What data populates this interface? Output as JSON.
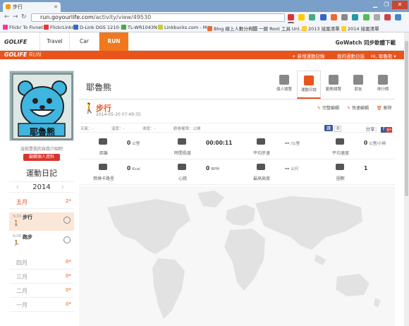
{
  "browser": {
    "tab_title": "步行",
    "url_domain": "run.goyourlife.com",
    "url_path": "/activity/view/49530",
    "bookmarks": [
      "Flickr To Fivnet",
      "FlickrLinkr",
      "D-Link DGS 1210-16",
      "TL-WR1043N",
      "Linkbucks.com - M...",
      "Blog 線上人數分佈",
      "一鍵 Root 工具 Unl...",
      "2013 接案清單",
      "2014 接案清單"
    ]
  },
  "site": {
    "logo": "GOLIFE",
    "tabs": [
      "Travel",
      "Car",
      "RUN"
    ],
    "active_tab": "RUN",
    "gowatch": "GoWatch 同步軟體下載",
    "run_logo_a": "GOLIFE",
    "run_logo_b": "RUN",
    "links": [
      "+ 新增運動記錄",
      "我的運動日誌",
      "Hi, 耶魯熊 ▾"
    ]
  },
  "profile": {
    "avatar_text": "耶魯熊",
    "motto": "這就是我的自我介紹吧",
    "edit_button": "編輯個人資料"
  },
  "diary": {
    "title": "運動日記",
    "year": "2014",
    "months": [
      {
        "name": "五月",
        "count": "2*",
        "active": true
      },
      {
        "name": "四月",
        "count": "0*"
      },
      {
        "name": "三月",
        "count": "0*"
      },
      {
        "name": "二月",
        "count": "0*"
      },
      {
        "name": "一月",
        "count": "0*"
      }
    ],
    "entries": [
      {
        "date": "5/20",
        "name": "步行",
        "selected": true
      },
      {
        "date": "5/20",
        "name": "跑步"
      }
    ]
  },
  "main": {
    "username": "耶魯熊",
    "nav": [
      "個人總覽",
      "運動日誌",
      "動態總覽",
      "朋友",
      "排行榜"
    ],
    "activity": {
      "name": "步行",
      "time": "2014-05-20 07:49:35",
      "actions": [
        "完整編輯",
        "快速編輯",
        "刪除"
      ]
    },
    "meta": [
      "天氣：-",
      "溫度：-",
      "濕度：-",
      "觀看權限：公開"
    ],
    "share_label": "分享：",
    "fb_button": "讚",
    "fb_count": "0",
    "stats": [
      {
        "label": "距離",
        "value": "0",
        "unit": "公里"
      },
      {
        "label": "時間長度",
        "value": "00:00:11",
        "unit": ""
      },
      {
        "label": "平均步速",
        "value": "--",
        "unit": "/公里"
      },
      {
        "label": "平均速度",
        "value": "0",
        "unit": "公里/小時"
      },
      {
        "label": "燃燒卡路里",
        "value": "0",
        "unit": "Kcal"
      },
      {
        "label": "心跳",
        "value": "0",
        "unit": "BPM"
      },
      {
        "label": "最高高度",
        "value": "--",
        "unit": "公尺"
      },
      {
        "label": "圈數",
        "value": "1",
        "unit": ""
      }
    ]
  }
}
